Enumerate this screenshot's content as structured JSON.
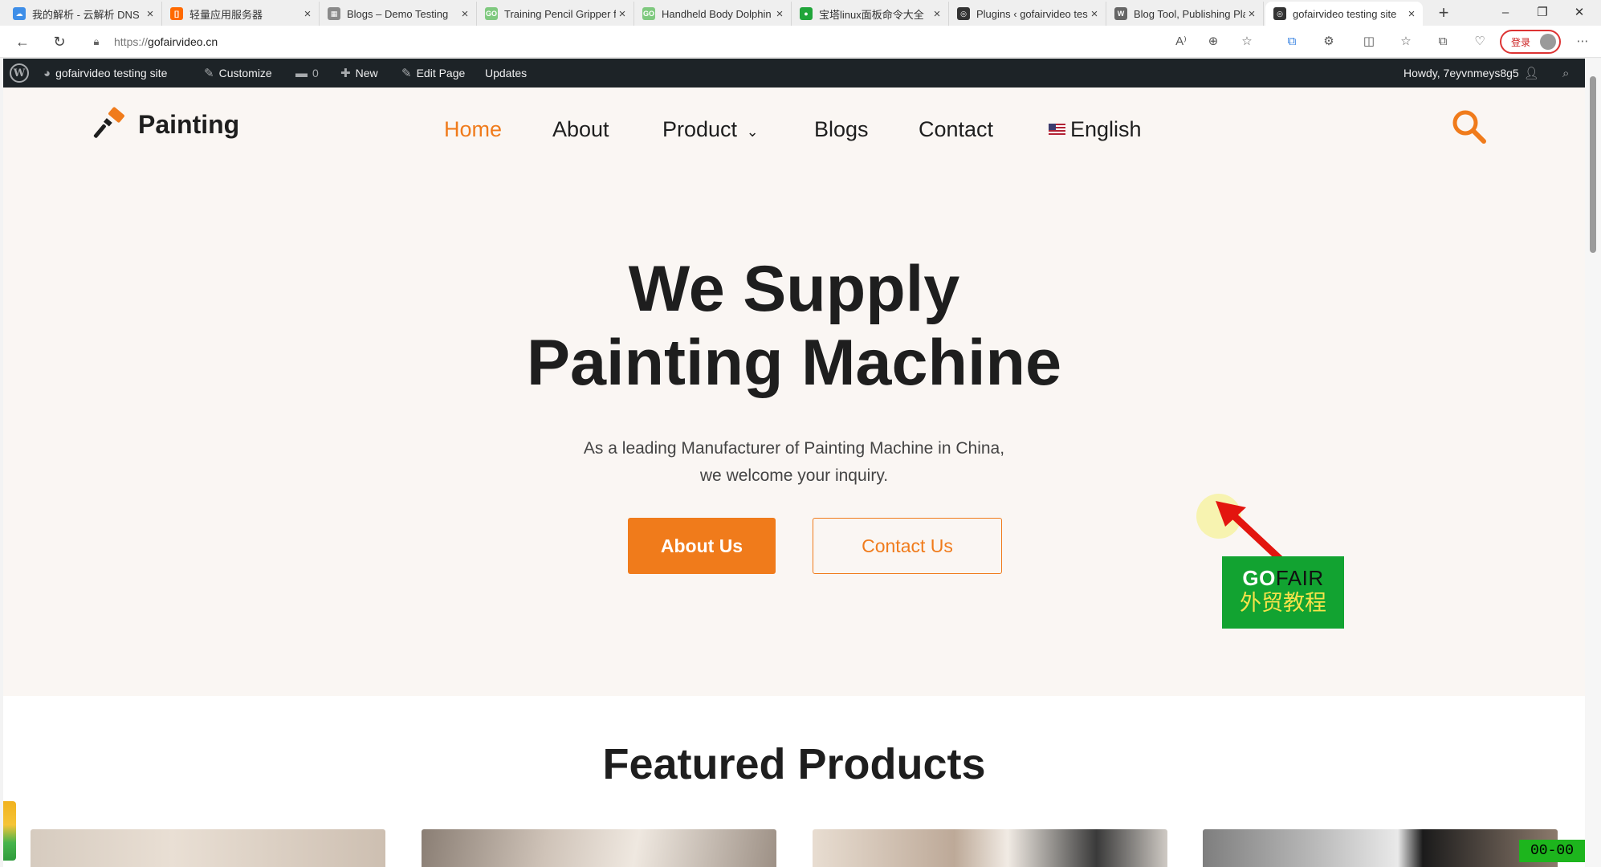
{
  "browser": {
    "tabs": [
      {
        "title": "我的解析 - 云解析 DNS",
        "color": "#3e8ee8",
        "glyph": "☁"
      },
      {
        "title": "轻量应用服务器",
        "color": "#ff6a00",
        "glyph": "[]"
      },
      {
        "title": "Blogs – Demo Testing",
        "color": "#8a8a8a",
        "glyph": "▦"
      },
      {
        "title": "Training Pencil Gripper f",
        "color": "#7fc97f",
        "glyph": "GO"
      },
      {
        "title": "Handheld Body Dolphin",
        "color": "#7fc97f",
        "glyph": "GO"
      },
      {
        "title": "宝塔linux面板命令大全",
        "color": "#20a53a",
        "glyph": "●"
      },
      {
        "title": "Plugins ‹ gofairvideo tes",
        "color": "#333333",
        "glyph": "◎"
      },
      {
        "title": "Blog Tool, Publishing Pla",
        "color": "#666666",
        "glyph": "W"
      },
      {
        "title": "gofairvideo testing site",
        "color": "#333333",
        "glyph": "◎"
      }
    ],
    "url_protocol": "https://",
    "url_host": "gofairvideo.cn",
    "login_label": "登录"
  },
  "adminbar": {
    "site_name": "gofairvideo testing site",
    "customize": "Customize",
    "comments_count": "0",
    "new": "New",
    "edit_page": "Edit Page",
    "updates": "Updates",
    "howdy": "Howdy, 7eyvnmeys8g5"
  },
  "site": {
    "logo_text": "Painting",
    "nav": {
      "home": "Home",
      "about": "About",
      "product": "Product",
      "blogs": "Blogs",
      "contact": "Contact",
      "language": "English"
    },
    "accent_color": "#f07b1b",
    "hero": {
      "title_line1": "We Supply",
      "title_line2": "Painting Machine",
      "subtitle_line1": "As a leading Manufacturer of Painting Machine in China,",
      "subtitle_line2": "we welcome your inquiry.",
      "primary_button": "About Us",
      "secondary_button": "Contact Us"
    },
    "featured_title": "Featured Products"
  },
  "overlay": {
    "badge_go": "GO",
    "badge_fair": "FAIR",
    "badge_cn": "外贸教程",
    "timer": "00-00"
  }
}
